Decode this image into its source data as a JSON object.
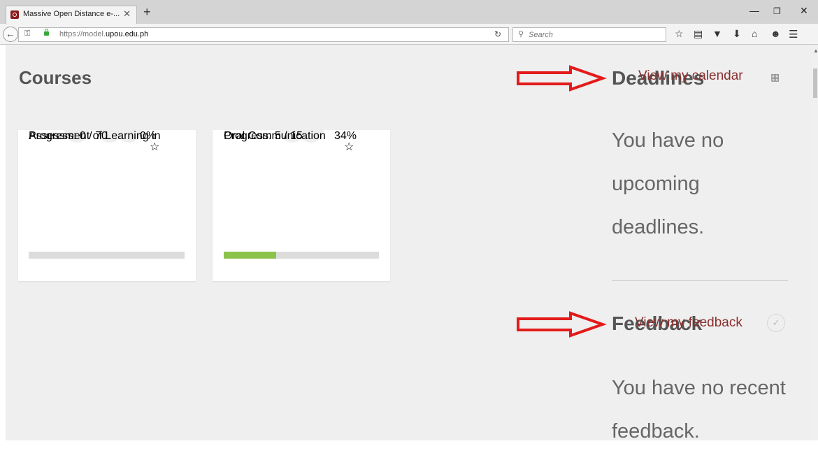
{
  "browser": {
    "tab_title": "Massive Open Distance e-...",
    "tab_close": "✕",
    "new_tab": "+",
    "url_prefix": "https://model.",
    "url_domain": "upou.edu.ph",
    "search_placeholder": "Search",
    "reload_icon": "reload-icon",
    "window_controls": [
      "—",
      "❐",
      "✕"
    ]
  },
  "page": {
    "courses_heading": "Courses",
    "courses": [
      {
        "title": "Assessment of Learning in",
        "progress_label": "Progress: 0 / 70",
        "percent_label": "0%",
        "progress": 0.0,
        "starred": false
      },
      {
        "title": "Oral Communication",
        "progress_label": "Progress: 5 / 15",
        "percent_label": "34%",
        "progress": 0.34,
        "starred": false
      }
    ],
    "deadlines": {
      "heading": "Deadlines",
      "link": "View my calendar",
      "empty_text": "You have no upcoming deadlines."
    },
    "feedback": {
      "heading": "Feedback",
      "link": "View my feedback",
      "empty_text": "You have no recent feedback."
    }
  },
  "colors": {
    "accent": "#7a2a2a",
    "star": "#f2c40b",
    "progress_fill": "#8bc34a",
    "annotation_arrow": "#e31b1b"
  }
}
